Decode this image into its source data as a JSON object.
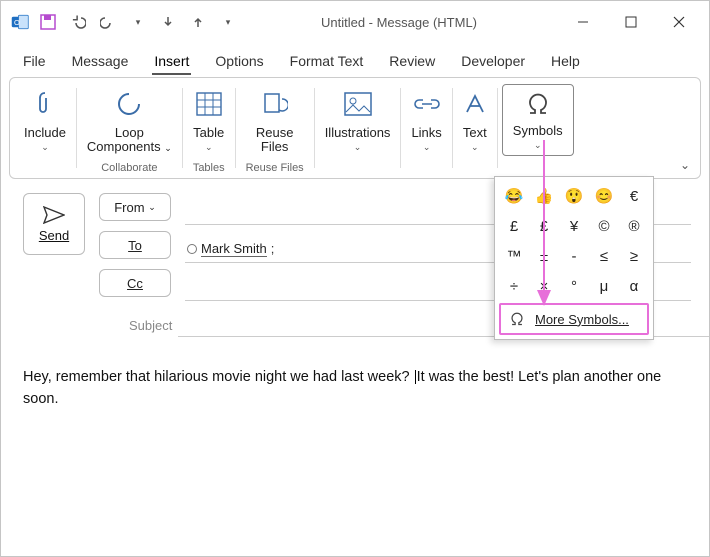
{
  "window": {
    "title": "Untitled  -  Message (HTML)"
  },
  "tabs": {
    "file": "File",
    "message": "Message",
    "insert": "Insert",
    "options": "Options",
    "format": "Format Text",
    "review": "Review",
    "developer": "Developer",
    "help": "Help"
  },
  "ribbon": {
    "include": "Include",
    "loop_label1": "Loop",
    "loop_label2": "Components",
    "collaborate_footer": "Collaborate",
    "table": "Table",
    "tables_footer": "Tables",
    "reuse1": "Reuse",
    "reuse2": "Files",
    "reuse_footer": "Reuse Files",
    "illustrations": "Illustrations",
    "links": "Links",
    "text": "Text",
    "symbols": "Symbols"
  },
  "symbol_grid": [
    "😂",
    "👍",
    "😲",
    "😊",
    "€",
    "£",
    "£",
    "¥",
    "©",
    "®",
    "™",
    "±",
    "-",
    "≤",
    "≥",
    "÷",
    "×",
    "°",
    "μ",
    "α"
  ],
  "more_symbols": "More Symbols...",
  "compose": {
    "send": "Send",
    "from": "From",
    "to": "To",
    "cc": "Cc",
    "recipient": "Mark Smith",
    "subject_label": "Subject"
  },
  "body": {
    "part1": "Hey, remember that hilarious movie night we had last week? ",
    "part2": "It was the best! Let's plan another one soon."
  }
}
